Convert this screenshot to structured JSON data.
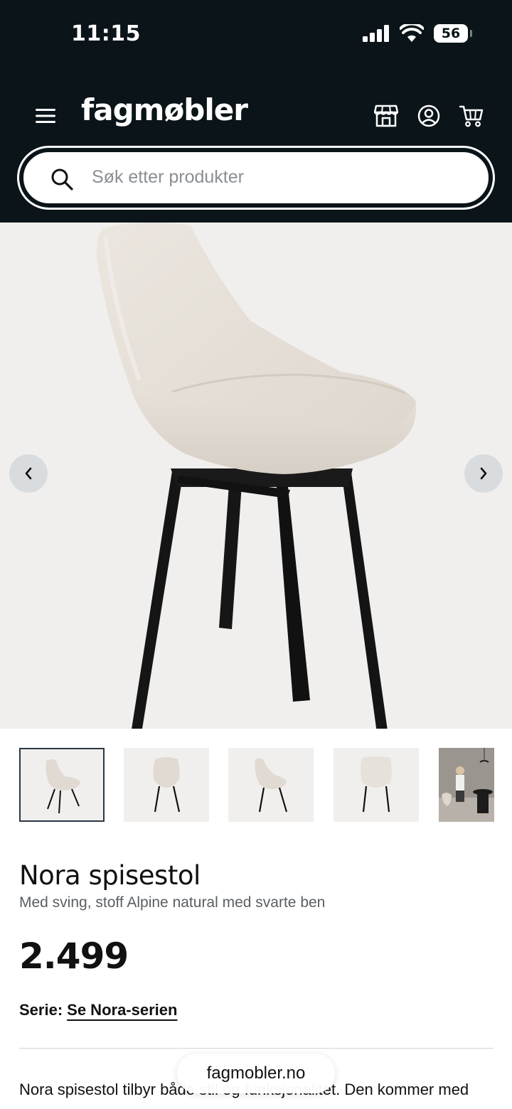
{
  "status_bar": {
    "time": "11:15",
    "battery": "56"
  },
  "header": {
    "logo": "fagmøbler",
    "icons": [
      "menu-icon",
      "store-icon",
      "account-icon",
      "cart-icon"
    ]
  },
  "search": {
    "placeholder": "Søk etter produkter"
  },
  "carousel": {
    "prev_icon": "chevron-left-icon",
    "next_icon": "chevron-right-icon"
  },
  "product": {
    "title": "Nora spisestol",
    "subtitle": "Med sving, stoff Alpine natural med svarte ben",
    "price": "2.499",
    "series_label": "Serie:",
    "series_link": "Se Nora-serien",
    "description": "Nora spisestol tilbyr både stil og funksjonalitet. Den kommer med"
  },
  "browser": {
    "url": "fagmobler.no"
  },
  "colors": {
    "header_bg": "#0b1418",
    "hero_bg": "#f1efed",
    "chair_fabric": "#e3ddd5"
  }
}
